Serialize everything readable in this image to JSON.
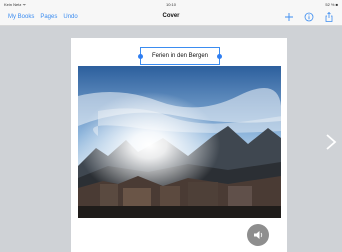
{
  "status": {
    "carrier": "Kein Netz ᯤ",
    "time": "10:10",
    "battery": "52 % ■"
  },
  "navbar": {
    "my_books": "My Books",
    "pages": "Pages",
    "undo": "Undo",
    "title": "Cover",
    "accent_color": "#3b8cf0"
  },
  "page": {
    "title_text": "Ferien in den Bergen"
  },
  "icons": [
    "plus-icon",
    "info-icon",
    "share-icon",
    "speaker-icon",
    "chevron-right-icon"
  ]
}
